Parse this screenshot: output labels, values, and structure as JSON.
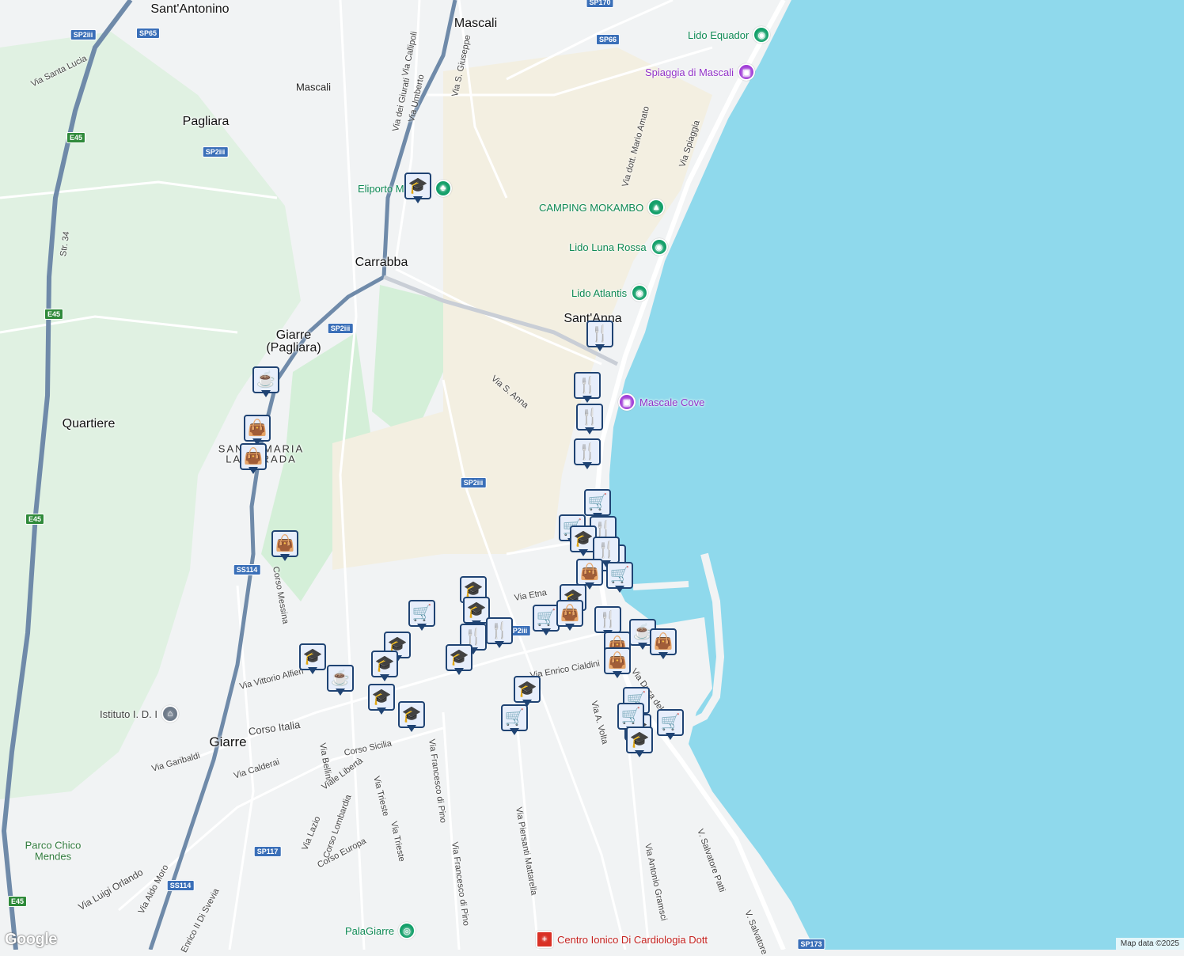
{
  "map": {
    "colors": {
      "sea": "#8fd9ec",
      "land": "#f1f3f4",
      "park": "#d4efd8",
      "forest": "#e0f1e2",
      "sand": "#f3efe1",
      "road": "#ffffff",
      "highway": "#6f8aa9"
    },
    "places": [
      {
        "text": "Sant'Antonino",
        "class": "town"
      },
      {
        "text": "Mascali",
        "class": "town"
      },
      {
        "text": "Pagliara",
        "class": "town"
      },
      {
        "text": "Carrabba",
        "class": "town"
      },
      {
        "text": "Giarre",
        "class": "town"
      },
      {
        "text": "(Pagliara)",
        "class": "town"
      },
      {
        "text": "Quartiere",
        "class": "town"
      },
      {
        "text": "Sant'Anna",
        "class": "town"
      },
      {
        "text": "Giarre",
        "class": "town"
      },
      {
        "text": "SANTA MARIA",
        "class": "small"
      },
      {
        "text": "LA STRADA",
        "class": "small"
      },
      {
        "text": "Parco Chico",
        "class": ""
      },
      {
        "text": "Mendes",
        "class": ""
      },
      {
        "text": "Mascali",
        "class": ""
      }
    ],
    "streets": [
      "Via Santa Lucia",
      "Via Callipoli",
      "Via dei Giurati",
      "Via Umberto",
      "Via S. Giuseppe",
      "Str. 34",
      "Via dott. Mario Amato",
      "Via Spiaggia",
      "Via S. Anna",
      "Via Etna",
      "Via Enrico Cialdini",
      "Via Duca del Mare",
      "Via A. Volta",
      "Corso Messina",
      "Via Vittorio Alfieri",
      "Corso Italia",
      "Via Garibaldi",
      "Via Calderai",
      "Corso Sicilia",
      "Via Bellini",
      "Viale Libertà",
      "Via Trieste",
      "Via Francesco di Pino",
      "Via Lazio",
      "Corso Lombardia",
      "Corso Europa",
      "Via Trieste",
      "Via Francesco di Pino",
      "Via Piersanti Mattarella",
      "Via Antonio Gramsci",
      "V. Salvatore Patti",
      "V. Salvatore",
      "Via Luigi Orlando",
      "Via Aldo Moro",
      "Enrico II Di Svevia"
    ],
    "pois": [
      {
        "text": "Lido Equador",
        "kind": "green",
        "icon": "beach-icon"
      },
      {
        "text": "Spiaggia di Mascali",
        "kind": "purple",
        "icon": "camera-icon"
      },
      {
        "text": "Eliporto Mascali",
        "kind": "green",
        "icon": "tree-icon"
      },
      {
        "text": "CAMPING MOKAMBO",
        "kind": "green",
        "icon": "tent-icon"
      },
      {
        "text": "Lido Luna Rossa",
        "kind": "green",
        "icon": "beach-icon"
      },
      {
        "text": "Lido Atlantis",
        "kind": "green",
        "icon": "beach-icon"
      },
      {
        "text": "Mascale Cove",
        "kind": "purple",
        "icon": "camera-icon"
      },
      {
        "text": "Istituto I. D. I",
        "kind": "blue",
        "icon": "school-icon"
      },
      {
        "text": "PalaGiarre",
        "kind": "green",
        "icon": "stadium-icon"
      },
      {
        "text": "Centro Ionico Di Cardiologia Dott",
        "kind": "red",
        "icon": "hospital-icon"
      }
    ],
    "shields": [
      "SP170",
      "SP2iii",
      "SP65",
      "SP66",
      "E45",
      "SP2iii",
      "E45",
      "SP2iii",
      "E45",
      "SP2iii",
      "SS114",
      "SP2iii",
      "SP117",
      "SS114",
      "E45",
      "SP173"
    ],
    "markers": [
      "school-icon",
      "coffee-icon",
      "shopping-bag-icon",
      "shopping-bag-icon",
      "shopping-bag-icon",
      "restaurant-icon",
      "restaurant-icon",
      "restaurant-icon",
      "restaurant-icon",
      "shopping-cart-icon",
      "shopping-cart-icon",
      "restaurant-icon",
      "shopping-cart-icon",
      "school-icon",
      "restaurant-icon",
      "restaurant-icon",
      "shopping-bag-icon",
      "school-icon",
      "school-icon",
      "school-icon",
      "shopping-cart-icon",
      "school-icon",
      "school-icon",
      "restaurant-icon",
      "restaurant-icon",
      "shopping-cart-icon",
      "shopping-bag-icon",
      "restaurant-icon",
      "shopping-bag-icon",
      "coffee-icon",
      "shopping-bag-icon",
      "shopping-bag-icon",
      "school-icon",
      "coffee-icon",
      "school-icon",
      "school-icon",
      "school-icon",
      "school-icon",
      "shopping-cart-icon",
      "school-icon",
      "shopping-cart-icon",
      "shopping-cart-icon",
      "shopping-cart-icon",
      "school-icon"
    ],
    "branding": {
      "logo": "Google",
      "attribution": "Map data ©2025"
    }
  }
}
